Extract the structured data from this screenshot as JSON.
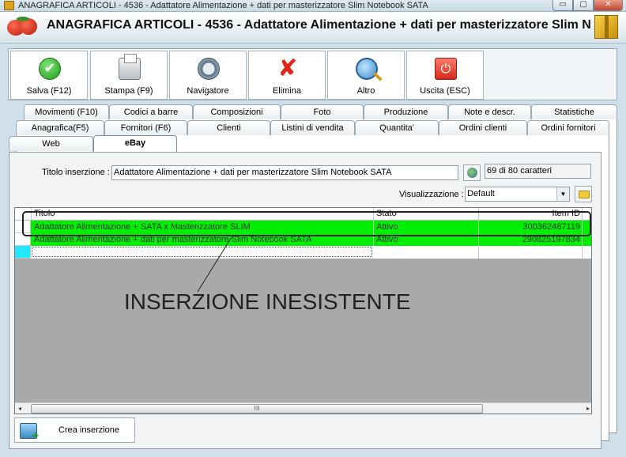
{
  "window": {
    "title": "ANAGRAFICA ARTICOLI - 4536 - Adattatore Alimentazione + dati per masterizzatore Slim Notebook SATA",
    "min_label": "▭",
    "max_label": "▢",
    "close_label": "✕"
  },
  "header": {
    "title": "ANAGRAFICA ARTICOLI - 4536 - Adattatore Alimentazione + dati per masterizzatore Slim N"
  },
  "toolbar": {
    "buttons": [
      {
        "label": "Salva (F12)",
        "icon": "check-icon",
        "glyph": "✔"
      },
      {
        "label": "Stampa (F9)",
        "icon": "printer-icon",
        "glyph": ""
      },
      {
        "label": "Navigatore",
        "icon": "compass-icon",
        "glyph": ""
      },
      {
        "label": "Elimina",
        "icon": "delete-x-icon",
        "glyph": "✘"
      },
      {
        "label": "Altro",
        "icon": "magnifier-icon",
        "glyph": ""
      },
      {
        "label": "Uscita (ESC)",
        "icon": "power-icon",
        "glyph": "⏻"
      }
    ]
  },
  "tabs": {
    "row1": [
      "Movimenti (F10)",
      "Codici a barre",
      "Composizioni",
      "Foto",
      "Produzione",
      "Note e descr.",
      "Statistiche"
    ],
    "row2": [
      "Anagrafica(F5)",
      "Fornitori (F6)",
      "Clienti",
      "Listini di vendita",
      "Quantita'",
      "Ordini clienti",
      "Ordini fornitori"
    ],
    "row3": [
      "Web",
      "eBay"
    ],
    "active": "eBay"
  },
  "form": {
    "title_label": "Titolo inserzione :",
    "title_value": "Adattatore Alimentazione + dati per masterizzatore Slim Notebook SATA",
    "char_count": "69 di 80 caratteri",
    "vis_label": "Visualizzazione :",
    "vis_value": "Default"
  },
  "grid": {
    "columns": [
      "Titolo",
      "Stato",
      "Item ID"
    ],
    "rows": [
      {
        "titolo": "Adattatore Alimentazione + SATA x Masterizzatore SLIM",
        "stato": "Attivo",
        "item_id": "300362487119"
      },
      {
        "titolo": "Adattatore Alimentazione + dati per masterizzatore Slim Notebook SATA",
        "stato": "Attivo",
        "item_id": "290825197834"
      }
    ],
    "row_color": "#00ee00",
    "new_row_indicator_color": "#22e7ff"
  },
  "scrollbar": {
    "left_arrow": "◂",
    "right_arrow": "▸",
    "grip": "III"
  },
  "annotation": {
    "text": "INSERZIONE INESISTENTE"
  },
  "footer": {
    "create_label": "Crea inserzione"
  }
}
